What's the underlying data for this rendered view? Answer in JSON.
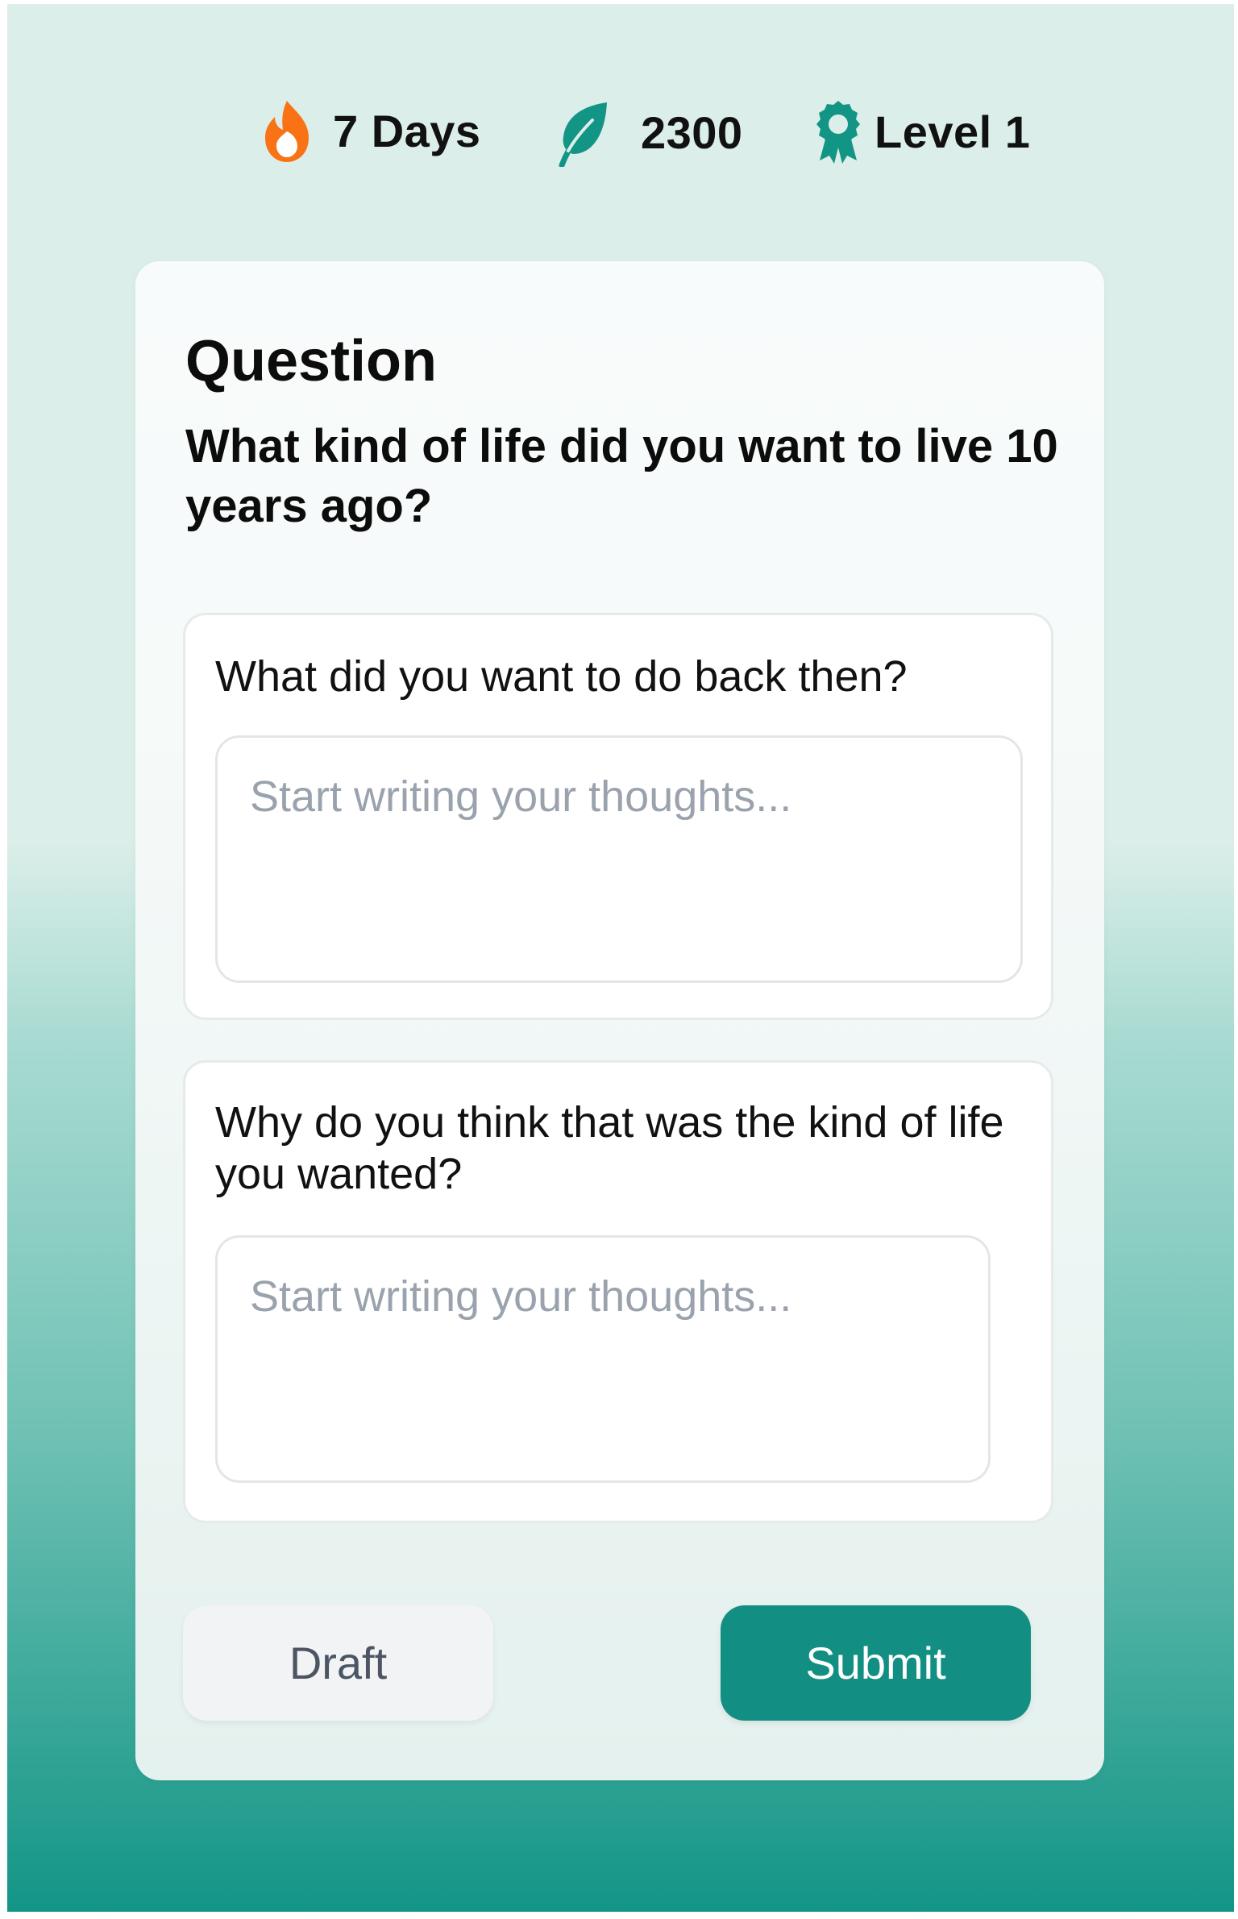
{
  "stats": {
    "streak": {
      "label": "7 Days",
      "icon": "flame-icon",
      "color": "#f97316"
    },
    "points": {
      "label": "2300",
      "icon": "leaf-icon",
      "color": "#139586"
    },
    "level": {
      "label": "Level 1",
      "icon": "award-badge-icon",
      "color": "#139586"
    }
  },
  "card": {
    "title": "Question",
    "question": "What kind of life did you want to live 10 years ago?"
  },
  "prompts": [
    {
      "text": "What did you want to do back then?",
      "placeholder": "Start writing your thoughts...",
      "value": ""
    },
    {
      "text": "Why do you think that was the kind of life you wanted?",
      "placeholder": "Start writing your thoughts...",
      "value": ""
    }
  ],
  "buttons": {
    "draft_label": "Draft",
    "submit_label": "Submit"
  },
  "colors": {
    "accent": "#128f82",
    "streak": "#f97316"
  }
}
